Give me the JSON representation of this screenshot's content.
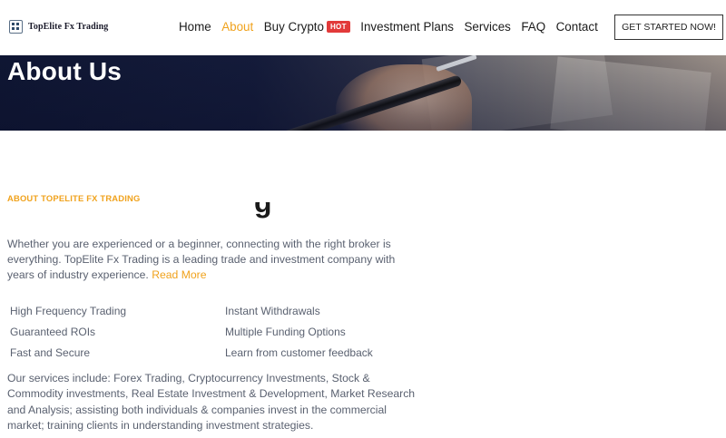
{
  "header": {
    "logo_text": "TopElite Fx Trading",
    "nav": [
      {
        "label": "Home",
        "active": false
      },
      {
        "label": "About",
        "active": true
      },
      {
        "label": "Buy Crypto",
        "active": false,
        "badge": "HOT"
      },
      {
        "label": "Investment Plans",
        "active": false
      },
      {
        "label": "Services",
        "active": false
      },
      {
        "label": "FAQ",
        "active": false
      },
      {
        "label": "Contact",
        "active": false
      }
    ],
    "cta_label": "GET STARTED NOW!"
  },
  "banner": {
    "title": "About Us"
  },
  "about": {
    "eyebrow": "ABOUT TOPELITE FX TRADING",
    "heading_partial": "g",
    "intro": "Whether you are experienced or a beginner, connecting with the right broker is everything. TopElite Fx Trading is a leading trade and investment company with years of industry experience.",
    "read_more": "Read More",
    "features": [
      "High Frequency Trading",
      "Instant Withdrawals",
      "Guaranteed ROIs",
      "Multiple Funding Options",
      "Fast and Secure",
      "Learn from customer feedback"
    ],
    "services": "Our services include: Forex Trading, Cryptocurrency Investments, Stock & Commodity investments, Real Estate Investment & Development, Market Research and Analysis; assisting both individuals & companies invest in the commercial market; training clients in understanding investment strategies."
  },
  "colors": {
    "accent": "#f0a21c",
    "hot_badge": "#e23a3a",
    "banner_dark": "#0f1633",
    "body_text": "#5a6170"
  }
}
